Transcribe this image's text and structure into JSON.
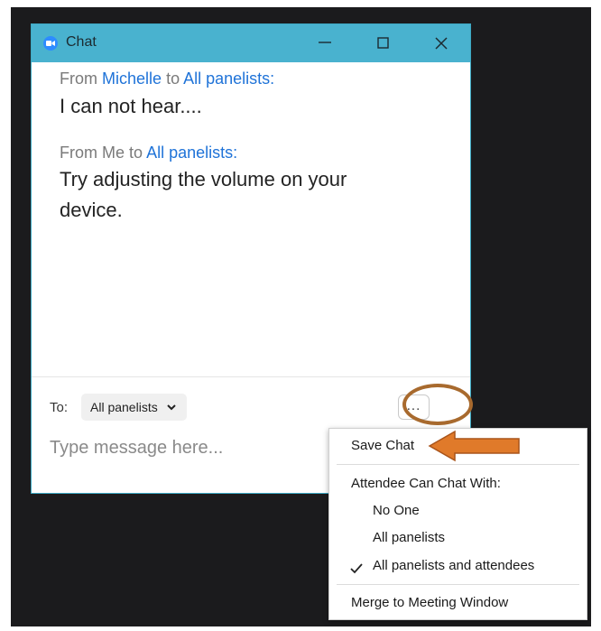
{
  "window": {
    "title": "Chat",
    "icon": "zoom-camera-icon",
    "accent_color": "#49b2cf"
  },
  "messages": [
    {
      "from_label": "From",
      "sender": "Michelle",
      "to_label": "to",
      "recipient": "All panelists:",
      "text": "I can not hear...."
    },
    {
      "from_label": "From",
      "sender": "Me",
      "to_label": "to",
      "recipient": "All panelists:",
      "text": "Try adjusting the volume on your device."
    }
  ],
  "composer": {
    "to_label": "To:",
    "recipient_selected": "All panelists",
    "placeholder": "Type message here...",
    "more_label": "..."
  },
  "menu": {
    "save_chat": "Save Chat",
    "section_header": "Attendee Can Chat With:",
    "options": [
      "No One",
      "All panelists",
      "All panelists and attendees"
    ],
    "selected_option": "All panelists and attendees",
    "merge": "Merge to Meeting Window"
  },
  "annotation": {
    "ring_color": "#a86a2e",
    "arrow_color": "#e07a2a"
  }
}
